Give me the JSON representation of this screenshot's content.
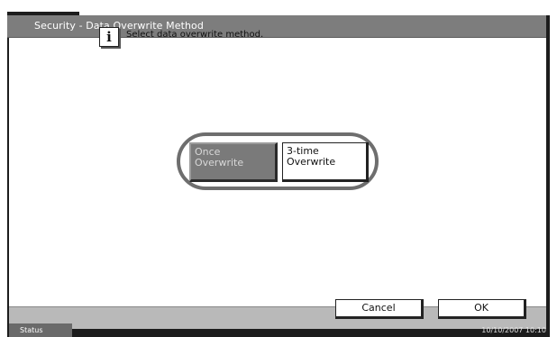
{
  "header": {
    "title": "Security - Data Overwrite Method"
  },
  "main": {
    "message": "Select data overwrite method.",
    "options": [
      {
        "label_line1": "Once",
        "label_line2": "Overwrite",
        "selected": true
      },
      {
        "label_line1": "3-time",
        "label_line2": "Overwrite",
        "selected": false
      }
    ]
  },
  "footer": {
    "cancel_label": "Cancel",
    "ok_label": "OK"
  },
  "status": {
    "label": "Status",
    "datetime": "10/10/2007   10:10"
  },
  "colors": {
    "titlebar": "#7d7d7d",
    "selected_option": "#7a7a7a",
    "bottombar": "#b9b9b9"
  }
}
